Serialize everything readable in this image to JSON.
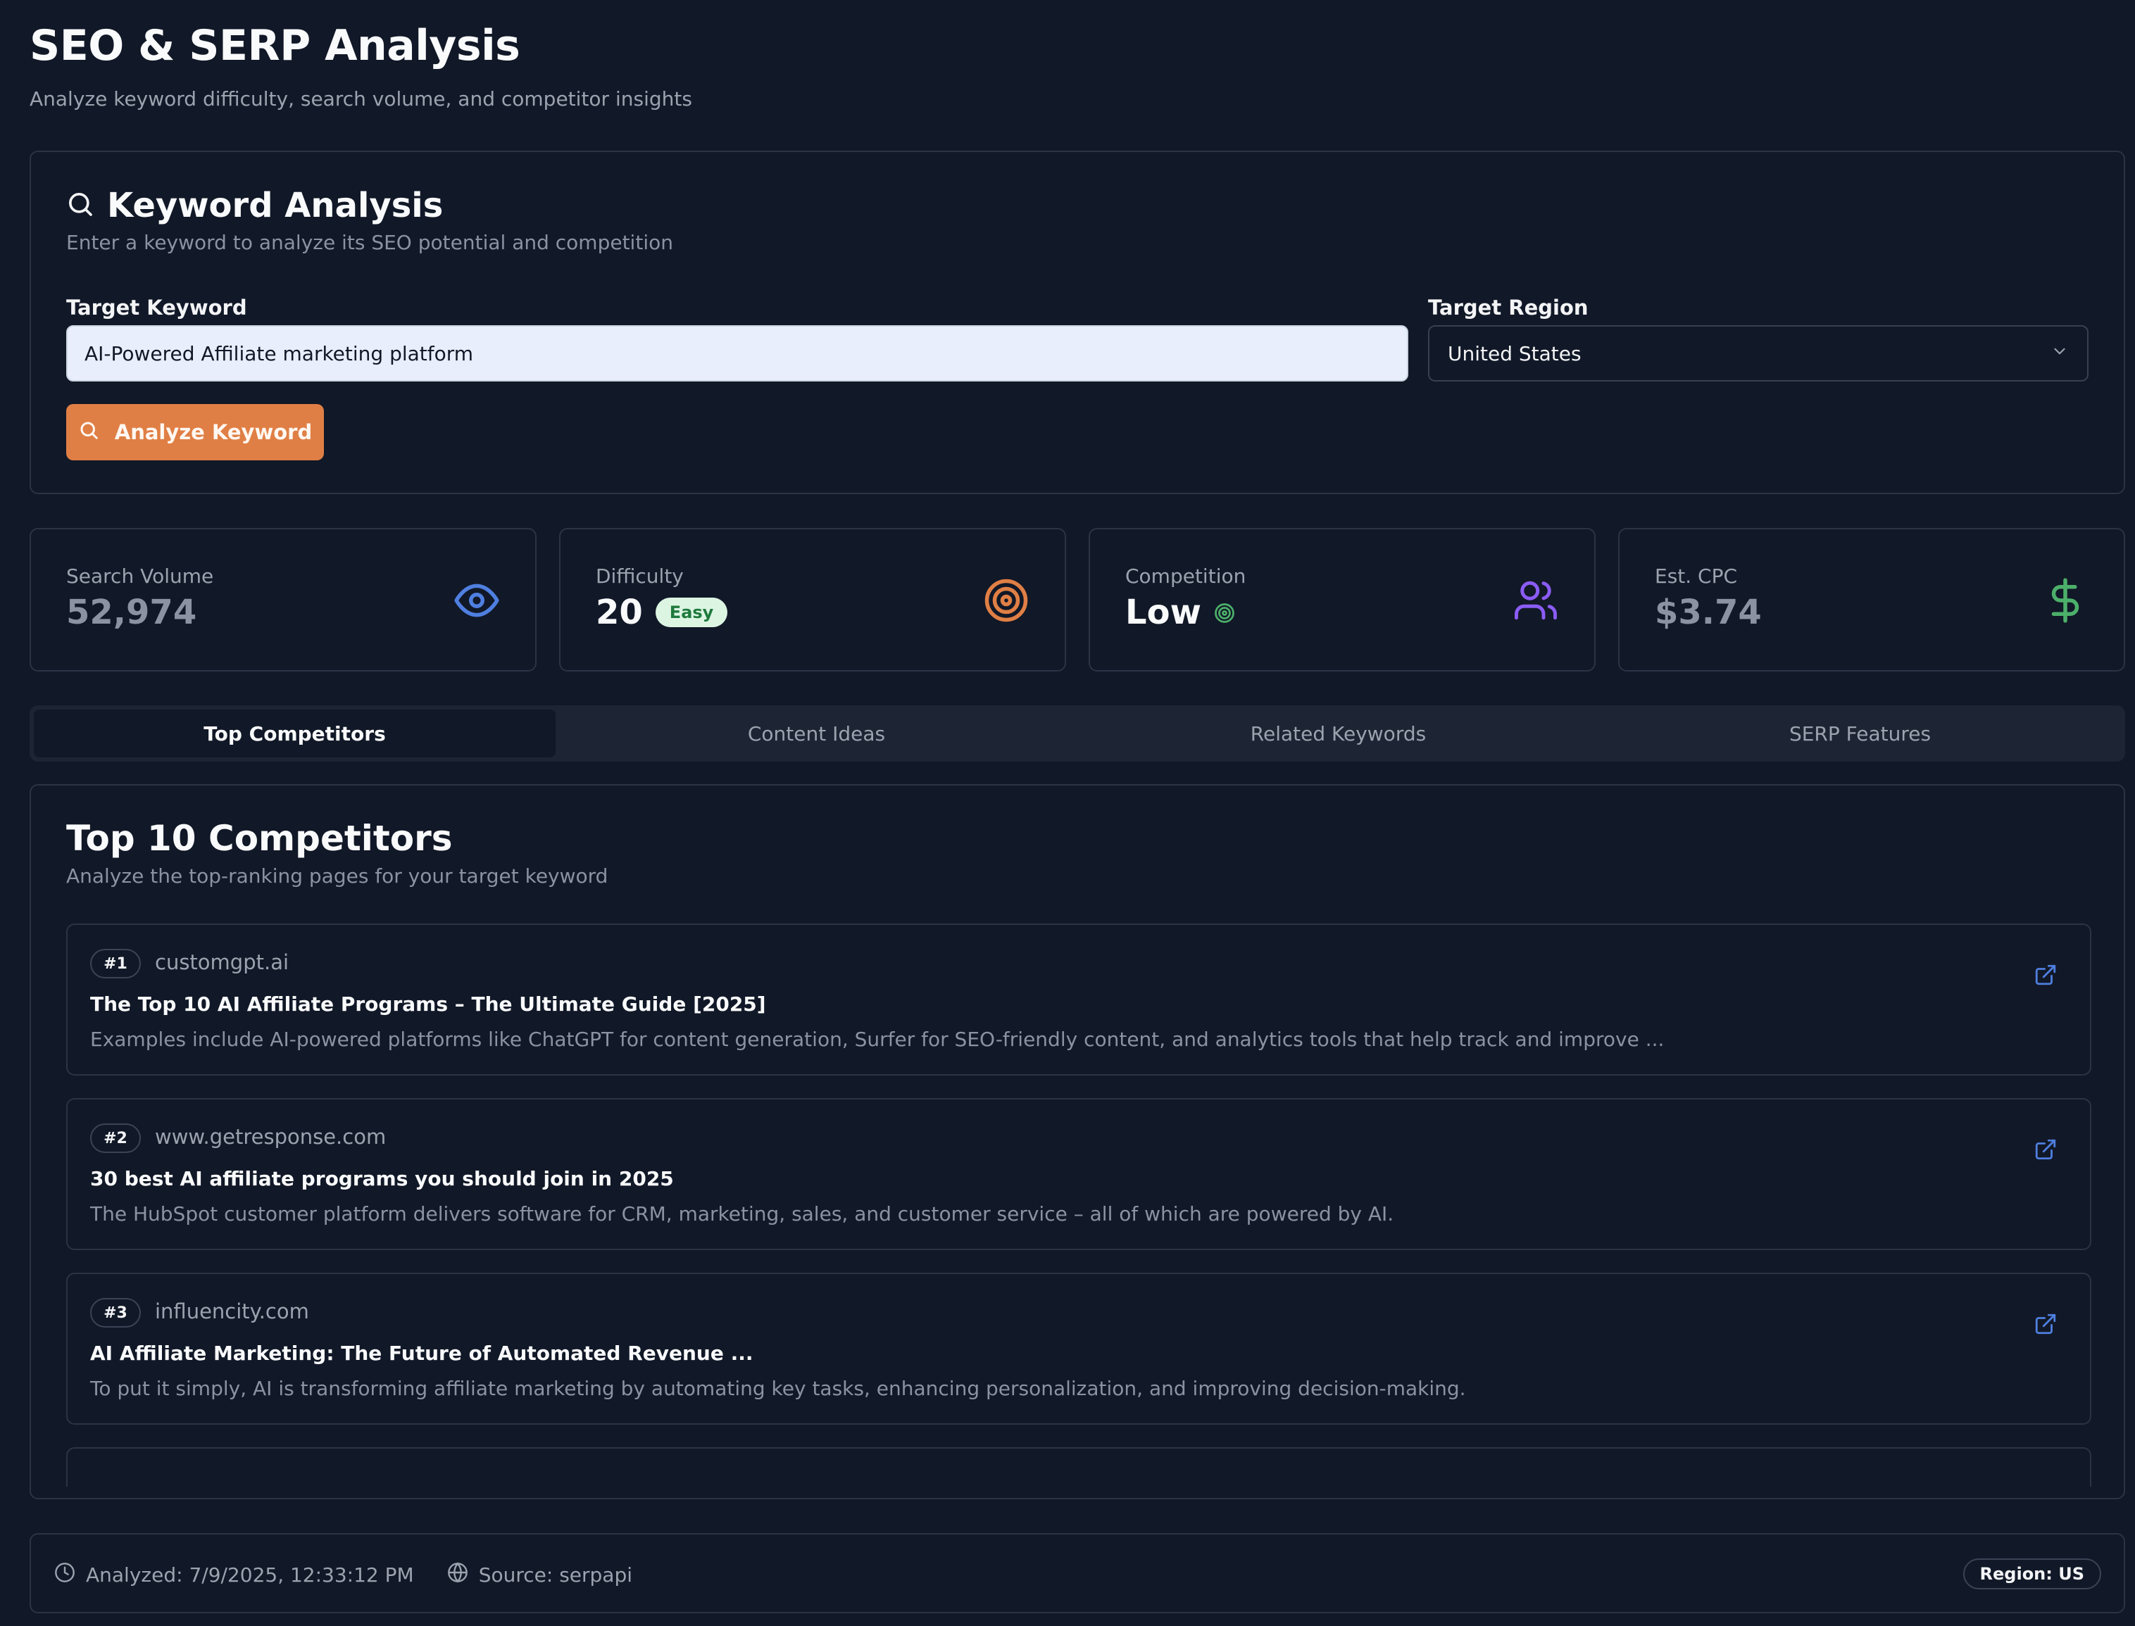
{
  "header": {
    "title": "SEO & SERP Analysis",
    "subtitle": "Analyze keyword difficulty, search volume, and competitor insights"
  },
  "keyword_analysis": {
    "title": "Keyword Analysis",
    "subtitle": "Enter a keyword to analyze its SEO potential and competition",
    "keyword_label": "Target Keyword",
    "keyword_value": "AI-Powered Affiliate marketing platform",
    "region_label": "Target Region",
    "region_value": "United States",
    "analyze_label": "Analyze Keyword"
  },
  "stats": {
    "search_volume": {
      "label": "Search Volume",
      "value": "52,974",
      "icon": "eye-icon",
      "color": "#4f7fe0"
    },
    "difficulty": {
      "label": "Difficulty",
      "value": "20",
      "badge": "Easy",
      "icon": "target-icon",
      "color": "#e07f45"
    },
    "competition": {
      "label": "Competition",
      "value": "Low",
      "icon": "users-icon",
      "color": "#8b5cf6"
    },
    "cpc": {
      "label": "Est. CPC",
      "value": "$3.74",
      "icon": "dollar-icon",
      "color": "#4caf6a"
    }
  },
  "tabs": [
    {
      "label": "Top Competitors",
      "active": true
    },
    {
      "label": "Content Ideas",
      "active": false
    },
    {
      "label": "Related Keywords",
      "active": false
    },
    {
      "label": "SERP Features",
      "active": false
    }
  ],
  "competitors": {
    "title": "Top 10 Competitors",
    "subtitle": "Analyze the top-ranking pages for your target keyword",
    "items": [
      {
        "rank": "#1",
        "domain": "customgpt.ai",
        "headline": "The Top 10 AI Affiliate Programs – The Ultimate Guide [2025]",
        "snippet": "Examples include AI-powered platforms like ChatGPT for content generation, Surfer for SEO-friendly content, and analytics tools that help track and improve ..."
      },
      {
        "rank": "#2",
        "domain": "www.getresponse.com",
        "headline": "30 best AI affiliate programs you should join in 2025",
        "snippet": "The HubSpot customer platform delivers software for CRM, marketing, sales, and customer service – all of which are powered by AI."
      },
      {
        "rank": "#3",
        "domain": "influencity.com",
        "headline": "AI Affiliate Marketing: The Future of Automated Revenue ...",
        "snippet": "To put it simply, AI is transforming affiliate marketing by automating key tasks, enhancing personalization, and improving decision-making."
      }
    ]
  },
  "footer": {
    "analyzed": "Analyzed: 7/9/2025, 12:33:12 PM",
    "source": "Source: serpapi",
    "region_badge": "Region: US"
  },
  "colors": {
    "background": "#111827",
    "accent": "#e07f45",
    "link": "#4f7fe0",
    "easy_badge_bg": "#dcf5e3",
    "easy_badge_text": "#1f7a3c",
    "low_indicator": "#4caf6a"
  }
}
